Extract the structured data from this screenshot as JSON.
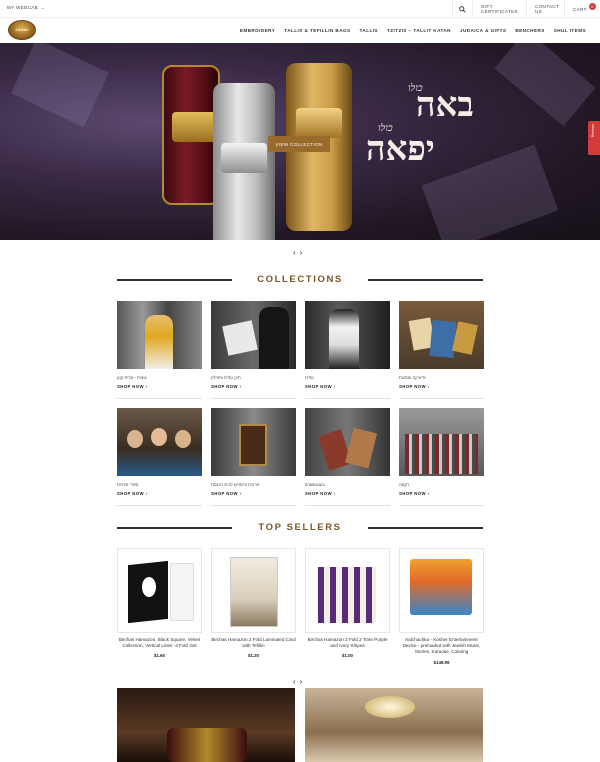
{
  "topbar": {
    "account_label": "MY WEBCAB",
    "gift_label": "GIFT CERTIFICATES",
    "contact_label": "CONTACT US",
    "cart_label": "CART",
    "cart_count": "0"
  },
  "logo": {
    "text": "ZAHAV"
  },
  "nav": {
    "items": [
      "EMBROIDERY",
      "TALLIS & TEFILLIN BAGS",
      "TALLIS",
      "TZITZIS – TALLIT KATAN",
      "JUDAICA & GIFTS",
      "BENCHERS",
      "SHUL ITEMS"
    ]
  },
  "hero": {
    "button_label": "VIEW COLLECTION",
    "hebrew_line1_small": "כולו",
    "hebrew_line1_big": "באה",
    "hebrew_line2_small": "כולו",
    "hebrew_line2_big": "יפאה",
    "side_tab_label": "Reviews"
  },
  "slider": {
    "prev": "‹",
    "next": "›"
  },
  "collections": {
    "title": "COLLECTIONS",
    "shop_label": "SHOP NOW",
    "items": [
      {
        "caption": "ציצית - טלית קטן"
      },
      {
        "caption": "תיק טלית ותפילין"
      },
      {
        "caption": "טלית"
      },
      {
        "caption": "יודאיקה ומתנות"
      },
      {
        "caption": "ספרי זמירות"
      },
      {
        "caption": "פרוכת וכיסויים לבית הכנסת"
      },
      {
        "caption": "בענטשערס"
      },
      {
        "caption": "רקמה"
      }
    ]
  },
  "top_sellers": {
    "title": "TOP SELLERS",
    "items": [
      {
        "name": "Birchas Hamazon, Black Square, Velvet Collection, Vertical Lines -3 Fold 4x6",
        "price": "$1.60"
      },
      {
        "name": "Birchas Hamazon 2 Fold Laminated Card with Tefillin",
        "price": "$1.20"
      },
      {
        "name": "Birchas Hamazon 2 Fold 2 Tone Purple and Ivory Stripes",
        "price": "$1.00"
      },
      {
        "name": "Kidchachka - Kosher Entertainment Device - preloaded with Jewish Music, Stories, Karaoke, Coloring",
        "price": "$149.99"
      }
    ]
  },
  "colors": {
    "accent": "#7a5626",
    "button": "#9a6a2d",
    "badge": "#d23b3b"
  }
}
